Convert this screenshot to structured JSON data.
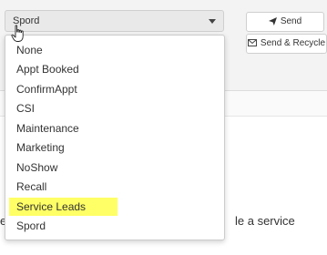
{
  "top_glyph": "‘",
  "select": {
    "value": "Spord"
  },
  "buttons": {
    "send": {
      "label": "Send",
      "icon": "paper-plane-icon"
    },
    "send_recycle": {
      "label": "Send & Recycle",
      "icon": "envelope-icon"
    }
  },
  "dropdown": {
    "options": [
      "None",
      "Appt Booked",
      "ConfirmAppt",
      "CSI",
      "Maintenance",
      "Marketing",
      "NoShow",
      "Recall",
      "Service Leads",
      "Spord"
    ],
    "highlighted": "Service Leads",
    "highlight_color": "#ffff66"
  },
  "background_text": {
    "left": "e",
    "right": "le a service"
  },
  "cursor": {
    "icon": "hand-pointer-icon"
  }
}
